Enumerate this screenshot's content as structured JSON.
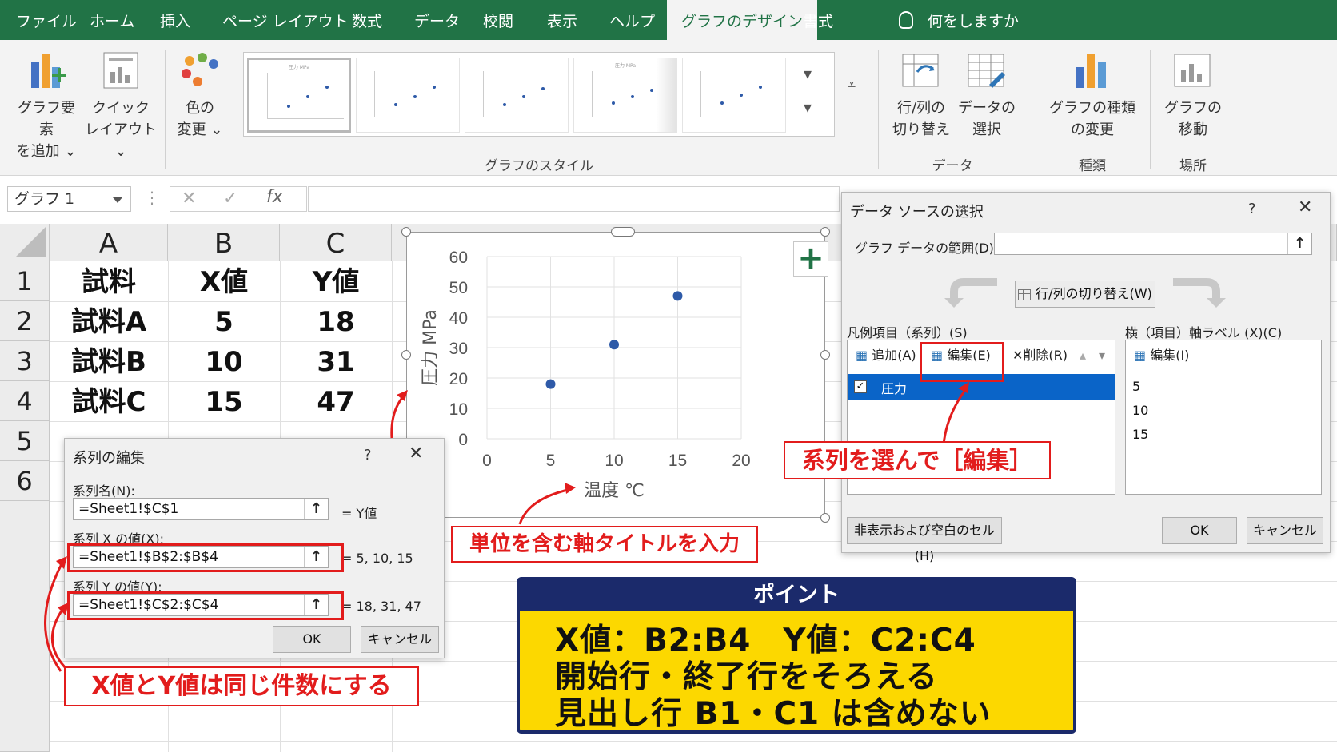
{
  "ribbon": {
    "tabs": [
      "ファイル",
      "ホーム",
      "挿入",
      "ページ レイアウト",
      "数式",
      "データ",
      "校閲",
      "表示",
      "ヘルプ",
      "グラフのデザイン",
      "書式"
    ],
    "active_tab": "グラフのデザイン",
    "tell_me": "何をしますか",
    "add_element": [
      "グラフ要素",
      "を追加 ⌄"
    ],
    "quick_layout": [
      "クイック",
      "レイアウト ⌄"
    ],
    "change_colors": [
      "色の",
      "変更 ⌄"
    ],
    "styles_group": "グラフのスタイル",
    "switch_row_col": [
      "行/列の",
      "切り替え"
    ],
    "select_data": [
      "データの",
      "選択"
    ],
    "data_group": "データ",
    "change_type": [
      "グラフの種類",
      "の変更"
    ],
    "type_group": "種類",
    "move_chart": [
      "グラフの",
      "移動"
    ],
    "location_group": "場所",
    "thumb_title": "圧力 MPa"
  },
  "formula_bar": {
    "name_box": "グラフ 1",
    "cancel": "✕",
    "enter": "✓",
    "fx": "fx"
  },
  "sheet": {
    "columns": [
      "A",
      "B",
      "C"
    ],
    "rows": [
      "1",
      "2",
      "3",
      "4",
      "5",
      "6"
    ],
    "cells": [
      [
        "試料",
        "X値",
        "Y値"
      ],
      [
        "試料A",
        "5",
        "18"
      ],
      [
        "試料B",
        "10",
        "31"
      ],
      [
        "試料C",
        "15",
        "47"
      ]
    ]
  },
  "chart_data": {
    "type": "scatter",
    "x": [
      5,
      10,
      15
    ],
    "y": [
      18,
      31,
      47
    ],
    "xlabel": "温度 ℃",
    "ylabel": "圧力 MPa",
    "xlim": [
      0,
      20
    ],
    "ylim": [
      0,
      60
    ],
    "xticks": [
      0,
      5,
      10,
      15,
      20
    ],
    "yticks": [
      0,
      10,
      20,
      30,
      40,
      50,
      60
    ],
    "grid": true,
    "color": "#2e5aa8"
  },
  "series_dialog": {
    "title": "系列の編集",
    "help": "?",
    "close": "✕",
    "name_label": "系列名(N):",
    "name_value": "=Sheet1!$C$1",
    "name_result": "= Y値",
    "x_label": "系列 X の値(X):",
    "x_value": "=Sheet1!$B$2:$B$4",
    "x_result": "= 5, 10, 15",
    "y_label": "系列 Y の値(Y):",
    "y_value": "=Sheet1!$C$2:$C$4",
    "y_result": "= 18, 31, 47",
    "ok": "OK",
    "cancel": "キャンセル"
  },
  "source_dialog": {
    "title": "データ ソースの選択",
    "help": "?",
    "close": "✕",
    "range_label": "グラフ データの範囲(D):",
    "switch_btn": "行/列の切り替え(W)",
    "legend_label": "凡例項目（系列）(S)",
    "axis_label": "横（項目）軸ラベル (X)(C)",
    "add": "追加(A)",
    "edit": "編集(E)",
    "remove": "削除(R)",
    "axis_edit": "編集(I)",
    "series_item": "圧力",
    "axis_items": [
      "5",
      "10",
      "15"
    ],
    "hidden_cells": "非表示および空白のセル(H)",
    "ok": "OK",
    "cancel": "キャンセル"
  },
  "callouts": {
    "select_edit": "系列を選んで［編集］",
    "axis_title": "単位を含む軸タイトルを入力",
    "same_count": "X値とY値は同じ件数にする"
  },
  "point": {
    "heading": "ポイント",
    "lines": [
      "X値：B2:B4　Y値：C2:C4",
      "開始行・終了行をそろえる",
      "見出し行 B1・C1 は含めない"
    ]
  },
  "colors": {
    "excel_green": "#217346",
    "accent_red": "#e21c1c",
    "point_yellow": "#fcd800",
    "point_navy": "#1b2a6b",
    "selection_blue": "#0a64c8"
  }
}
